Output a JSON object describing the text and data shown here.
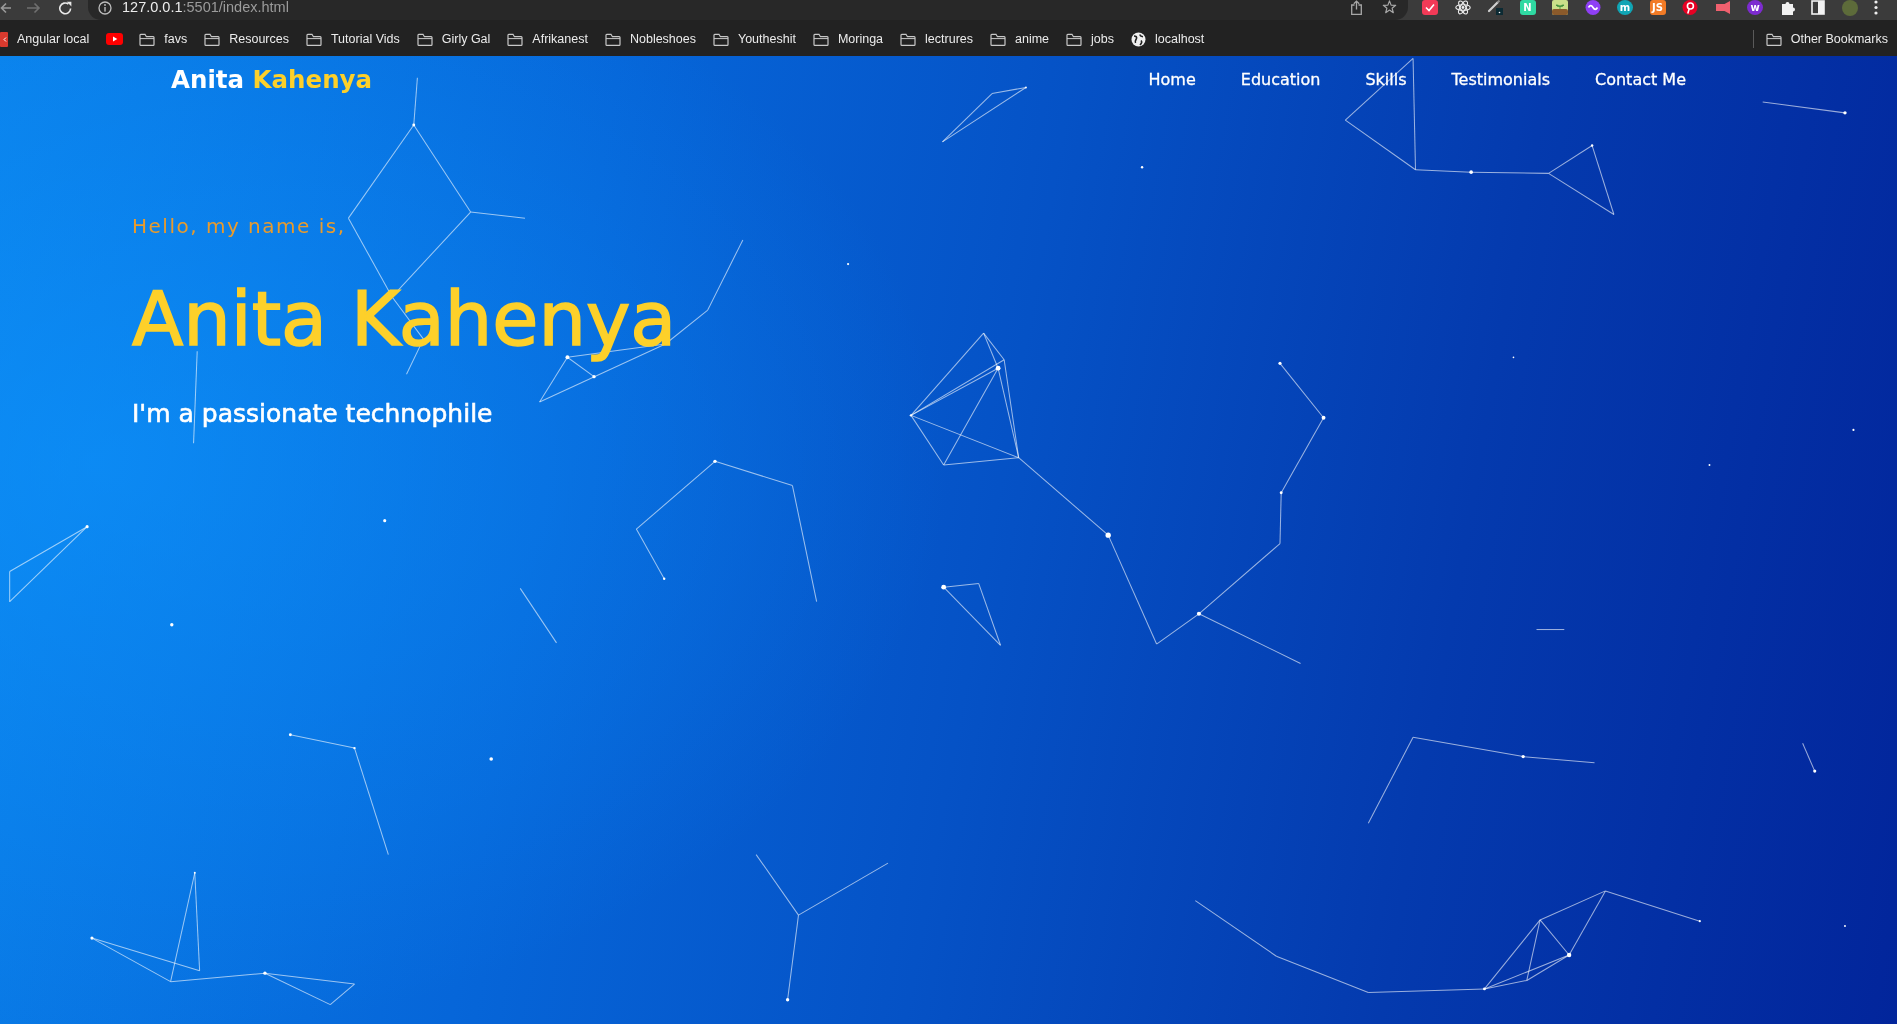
{
  "browser": {
    "url": {
      "host": "127.0.0.1",
      "path": ":5501/index.html"
    },
    "extensions": [
      {
        "kind": "calendar"
      },
      {
        "kind": "atom"
      },
      {
        "kind": "pen"
      },
      {
        "kind": "letter-tile",
        "glyph": "N",
        "color": "#2fd9a2"
      },
      {
        "kind": "plant"
      },
      {
        "kind": "loop"
      },
      {
        "kind": "letter-circle",
        "glyph": "m",
        "color": "#10a5b5"
      },
      {
        "kind": "letter-tile",
        "glyph": "JS",
        "color": "#f27b26"
      },
      {
        "kind": "pin"
      },
      {
        "kind": "video"
      },
      {
        "kind": "letter-circle",
        "glyph": "w",
        "color": "#7d2bd0"
      },
      {
        "kind": "puzzle"
      }
    ]
  },
  "bookmarks": [
    {
      "kind": "app",
      "label": "Angular local"
    },
    {
      "kind": "video"
    },
    {
      "kind": "folder",
      "label": "favs"
    },
    {
      "kind": "folder",
      "label": "Resources"
    },
    {
      "kind": "folder",
      "label": "Tutorial Vids"
    },
    {
      "kind": "folder",
      "label": "Girly Gal"
    },
    {
      "kind": "folder",
      "label": "Afrikanest"
    },
    {
      "kind": "folder",
      "label": "Nobleshoes"
    },
    {
      "kind": "folder",
      "label": "Youtheshit"
    },
    {
      "kind": "folder",
      "label": "Moringa"
    },
    {
      "kind": "folder",
      "label": "lectrures"
    },
    {
      "kind": "folder",
      "label": "anime"
    },
    {
      "kind": "folder",
      "label": "jobs"
    },
    {
      "kind": "site",
      "label": "localhost"
    }
  ],
  "other_bookmarks": {
    "label": "Other Bookmarks"
  },
  "header": {
    "logo": {
      "first": "Anita",
      "second": "Kahenya"
    },
    "nav": [
      {
        "label": "Home"
      },
      {
        "label": "Education"
      },
      {
        "label": "Skills"
      },
      {
        "label": "Testimonials"
      },
      {
        "label": "Contact Me"
      }
    ]
  },
  "hero": {
    "greeting": "Hello, my name is,",
    "name": "Anita Kahenya",
    "tagline": "I'm a passionate technophile"
  }
}
